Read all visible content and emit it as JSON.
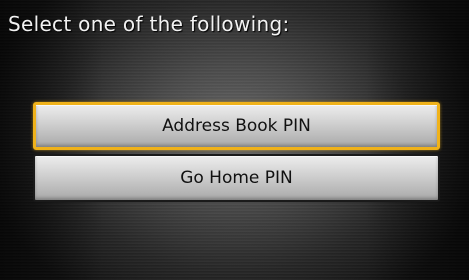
{
  "screen": {
    "prompt": "Select one of the following:"
  },
  "menu": {
    "items": [
      {
        "label": "Address Book PIN",
        "selected": true
      },
      {
        "label": "Go Home PIN",
        "selected": false
      }
    ]
  },
  "colors": {
    "selection_border": "#f0b21a",
    "button_face": "#cfcfcf",
    "prompt_text": "#f2f2f2"
  }
}
